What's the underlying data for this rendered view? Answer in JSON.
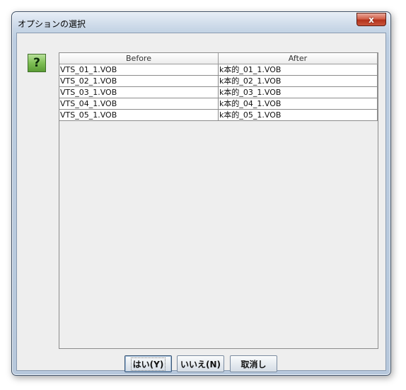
{
  "window": {
    "title": "オプションの選択",
    "close_symbol": "x"
  },
  "help_icon": {
    "glyph": "?",
    "icon": "question-icon",
    "color": "#7fbf55"
  },
  "table": {
    "headers": [
      "Before",
      "After"
    ],
    "rows": [
      [
        "VTS_01_1.VOB",
        "k本的_01_1.VOB"
      ],
      [
        "VTS_02_1.VOB",
        "k本的_02_1.VOB"
      ],
      [
        "VTS_03_1.VOB",
        "k本的_03_1.VOB"
      ],
      [
        "VTS_04_1.VOB",
        "k本的_04_1.VOB"
      ],
      [
        "VTS_05_1.VOB",
        "k本的_05_1.VOB"
      ]
    ]
  },
  "buttons": {
    "yes": "はい(Y)",
    "no": "いいえ(N)",
    "cancel": "取消し"
  }
}
